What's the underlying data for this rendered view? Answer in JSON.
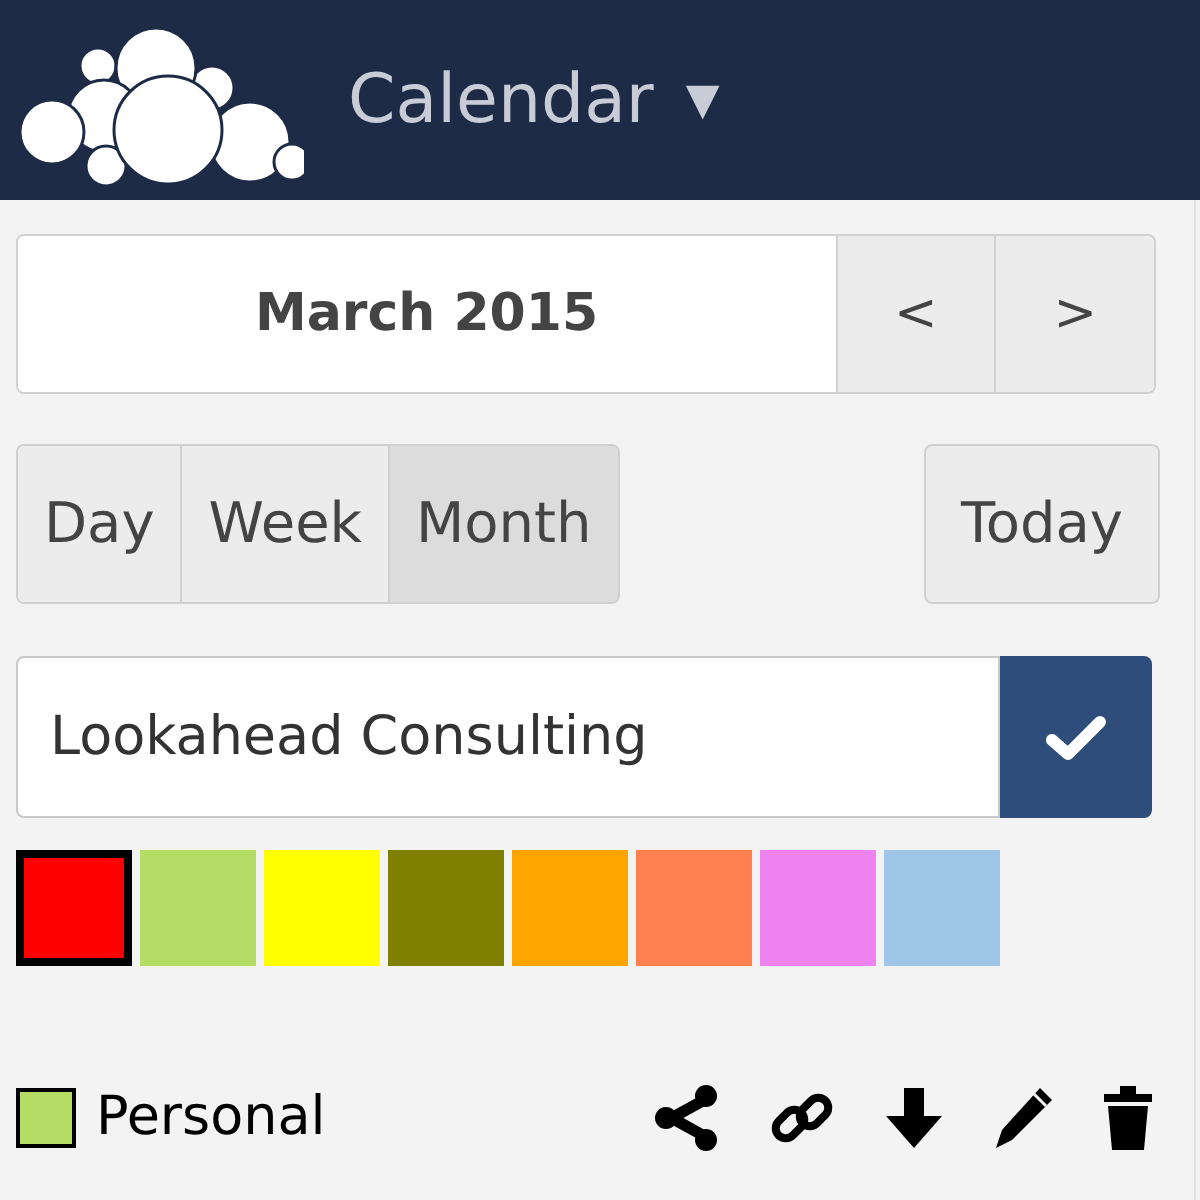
{
  "header": {
    "app_title": "Calendar",
    "menu_caret": "▼"
  },
  "navigation": {
    "period": "March 2015",
    "previous": "<",
    "next": ">"
  },
  "views": [
    {
      "label": "Day",
      "selected": false
    },
    {
      "label": "Week",
      "selected": false
    },
    {
      "label": "Month",
      "selected": true
    }
  ],
  "today_button": "Today",
  "new_calendar": {
    "value": "Lookahead Consulting"
  },
  "colors": [
    {
      "color": "#ff0000",
      "selected": true
    },
    {
      "color": "#b5dd66",
      "selected": false
    },
    {
      "color": "#ffff00",
      "selected": false
    },
    {
      "color": "#808000",
      "selected": false
    },
    {
      "color": "#ffa500",
      "selected": false
    },
    {
      "color": "#ff7f50",
      "selected": false
    },
    {
      "color": "#ee82ee",
      "selected": false
    },
    {
      "color": "#9fc6e7",
      "selected": false
    }
  ],
  "calendars": [
    {
      "name": "Personal",
      "color": "#b5dd66"
    }
  ]
}
